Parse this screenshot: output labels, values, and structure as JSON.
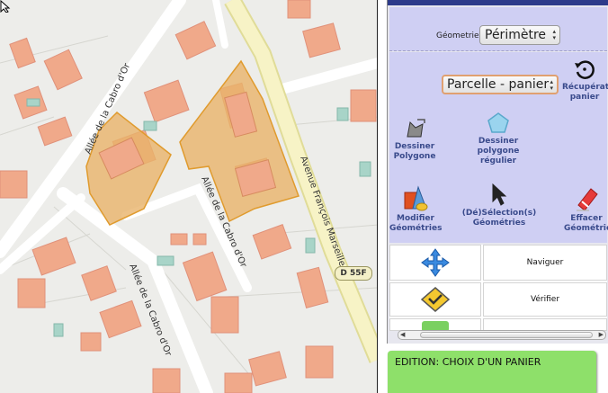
{
  "map": {
    "street_labels": [
      "Allée de la Cabro d'Or",
      "Allée de la Cabro d'Or",
      "Allée de la Cabro d'Or",
      "Avenue François Marseille"
    ],
    "road_badge": "D 55F"
  },
  "panel": {
    "geometry": {
      "label": "Géometrie",
      "selected": "Périmètre"
    },
    "basket": {
      "selected": "Parcelle - panier"
    },
    "tools": {
      "recover": "Récupération panier",
      "draw_polygon": "Dessiner Polygone",
      "draw_regular": "Dessiner polygone régulier",
      "modify": "Modifier Géométries",
      "select": "(Dé)Sélection(s) Géométries",
      "erase": "Effacer Géométrie"
    },
    "grid": {
      "navigate": "Naviguer",
      "verify": "Vérifier"
    }
  },
  "status": {
    "message": "EDITION: CHOIX D'UN PANIER"
  },
  "colors": {
    "parcel_fill": "#e8b36a",
    "parcel_stroke": "#e09b2e",
    "building": "#f0a98a",
    "panel_bg": "#cfcff3",
    "status_bg": "#8ee06a",
    "tool_text": "#3a4b8c"
  }
}
